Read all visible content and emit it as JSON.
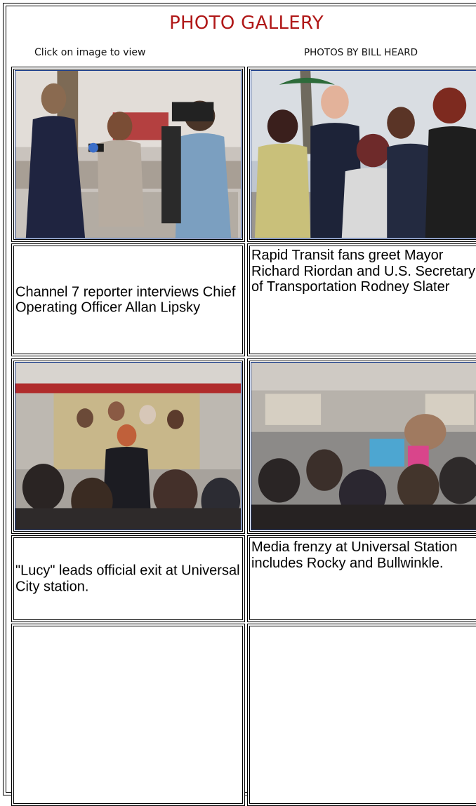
{
  "gallery": {
    "title": "PHOTO GALLERY",
    "instruction": "Click on image to view",
    "credit": "PHOTOS BY BILL HEARD"
  },
  "photos": [
    {
      "alt": "Channel 7 reporter interviewing a man in a suit while a cameraman films"
    },
    {
      "alt": "Group of people in costumes posing with officials"
    },
    {
      "alt": "Woman in polka dot dress leading crowd out of a train"
    },
    {
      "alt": "Crowd of media and costumed characters at a train station"
    }
  ],
  "captions": [
    "Channel 7 reporter interviews Chief Operating Officer  Allan Lipsky",
    "Rapid Transit fans greet Mayor Richard Riordan and U.S. Secretary of Transportation Rodney Slater",
    "\"Lucy\" leads official exit at Universal City station.",
    "Media frenzy at Universal Station includes Rocky and Bullwinkle."
  ],
  "colors": {
    "title": "#b01818",
    "photo_border": "#1d3f8c"
  }
}
